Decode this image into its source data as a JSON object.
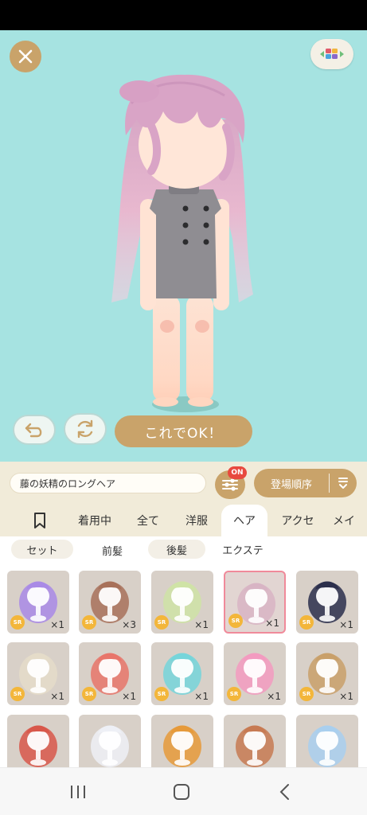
{
  "top_actions": {
    "ok_label": "これでOK！"
  },
  "item_name": "藤の妖精のロングヘア",
  "filter": {
    "badge": "ON"
  },
  "sort": {
    "label": "登場順序"
  },
  "tabs": [
    "着用中",
    "全て",
    "洋服",
    "ヘア",
    "アクセ",
    "メイ"
  ],
  "subtabs": [
    "セット",
    "前髪",
    "後髪",
    "エクステ"
  ],
  "items": [
    {
      "rarity": "SR",
      "count": "×1",
      "hair": "#a98ae6"
    },
    {
      "rarity": "SR",
      "count": "×3",
      "hair": "#a8715a"
    },
    {
      "rarity": "SR",
      "count": "×1",
      "hair": "#cfe3a6"
    },
    {
      "rarity": "SR",
      "count": "×1",
      "hair": "#d8b4c4"
    },
    {
      "rarity": "SR",
      "count": "×1",
      "hair": "#2c2f4c"
    },
    {
      "rarity": "SR",
      "count": "×1",
      "hair": "#e5dcc9"
    },
    {
      "rarity": "SR",
      "count": "×1",
      "hair": "#e8756a"
    },
    {
      "rarity": "SR",
      "count": "×1",
      "hair": "#76d5da"
    },
    {
      "rarity": "SR",
      "count": "×1",
      "hair": "#f39bc0"
    },
    {
      "rarity": "SR",
      "count": "×1",
      "hair": "#c9a06a"
    },
    {
      "rarity": "",
      "count": "",
      "hair": "#d8574a"
    },
    {
      "rarity": "",
      "count": "",
      "hair": "#eef0f6"
    },
    {
      "rarity": "",
      "count": "",
      "hair": "#e69a3a"
    },
    {
      "rarity": "",
      "count": "",
      "hair": "#c77a52"
    },
    {
      "rarity": "",
      "count": "",
      "hair": "#a9cfee"
    }
  ],
  "colors": {
    "accent": "#c9a36a",
    "stage": "#a6e3e1",
    "badge": "#e8493e",
    "selected_border": "#f08a9a"
  }
}
